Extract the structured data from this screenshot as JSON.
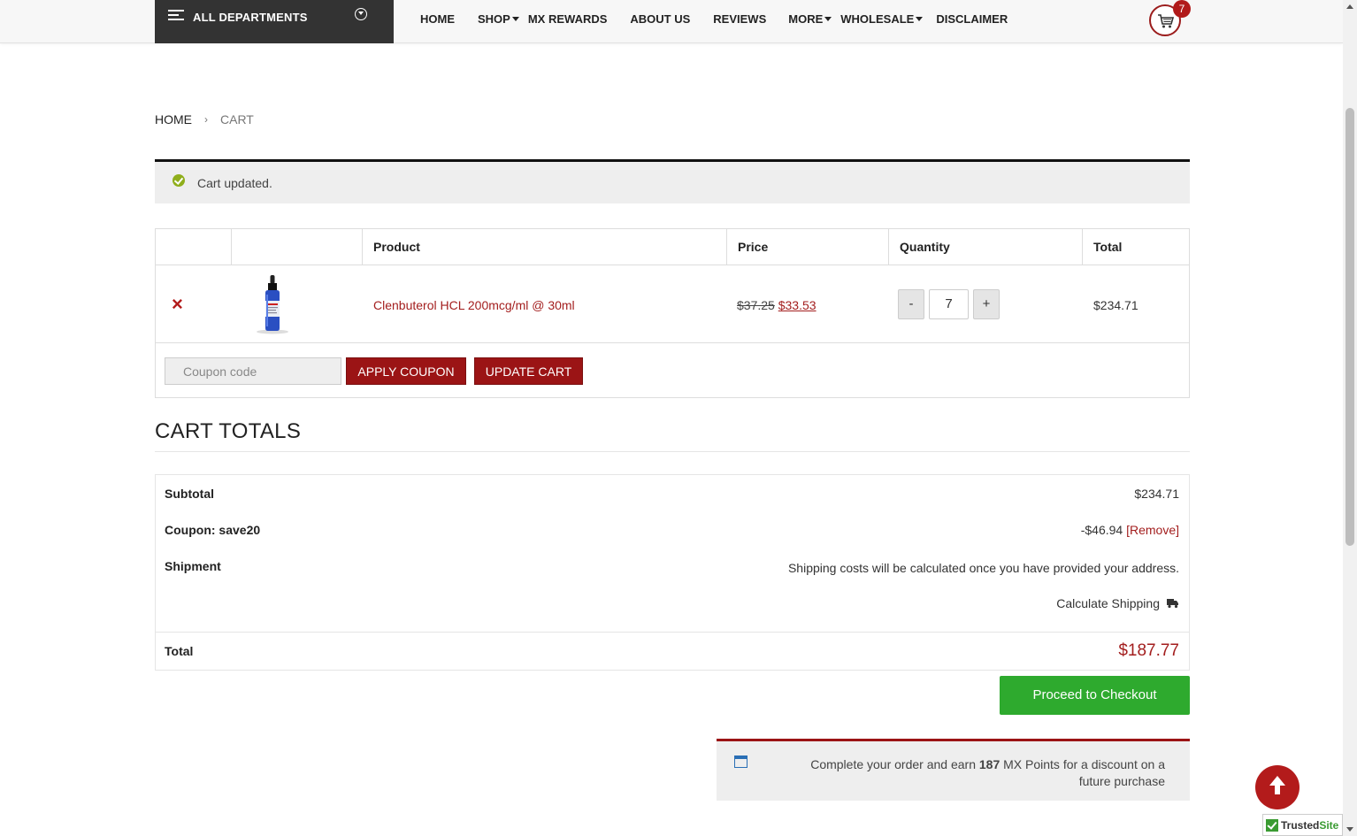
{
  "header": {
    "departments_label": "ALL DEPARTMENTS",
    "nav": [
      {
        "label": "HOME",
        "has_caret": false
      },
      {
        "label": "SHOP",
        "has_caret": true
      },
      {
        "label": "MX REWARDS",
        "has_caret": false
      },
      {
        "label": "ABOUT US",
        "has_caret": false
      },
      {
        "label": "REVIEWS",
        "has_caret": false
      },
      {
        "label": "MORE",
        "has_caret": true
      },
      {
        "label": "WHOLESALE",
        "has_caret": true
      },
      {
        "label": "DISCLAIMER",
        "has_caret": false
      }
    ],
    "cart_count": "7"
  },
  "breadcrumb": {
    "home": "HOME",
    "separator": "›",
    "current": "CART"
  },
  "notice": {
    "message": "Cart updated."
  },
  "cart_table": {
    "headers": {
      "product": "Product",
      "price": "Price",
      "quantity": "Quantity",
      "total": "Total"
    },
    "rows": [
      {
        "remove_icon": "×",
        "product": "Clenbuterol HCL 200mcg/ml @ 30ml",
        "old_price": "$37.25",
        "new_price": "$33.53",
        "quantity": "7",
        "total": "$234.71"
      }
    ],
    "qty_minus": "-",
    "qty_plus": "+",
    "coupon_placeholder": "Coupon code",
    "apply_coupon": "APPLY COUPON",
    "update_cart": "UPDATE CART"
  },
  "cart_totals": {
    "title": "CART TOTALS",
    "subtotal_label": "Subtotal",
    "subtotal_value": "$234.71",
    "coupon_label": "Coupon: save20",
    "coupon_value": "-$46.94",
    "coupon_remove": "[Remove]",
    "shipment_label": "Shipment",
    "shipment_note": "Shipping costs will be calculated once you have provided your address.",
    "calculate_shipping": "Calculate Shipping",
    "total_label": "Total",
    "total_value": "$187.77"
  },
  "checkout_label": "Proceed to Checkout",
  "points_message": {
    "before": "Complete your order and earn ",
    "points": "187",
    "after": " MX Points for a discount on a future purchase"
  },
  "trusted_badge": {
    "prefix": "Trusted",
    "suffix": "Site"
  },
  "colors": {
    "accent": "#9b1415",
    "checkout": "#2eaa2e",
    "link": "#a31e1e"
  }
}
